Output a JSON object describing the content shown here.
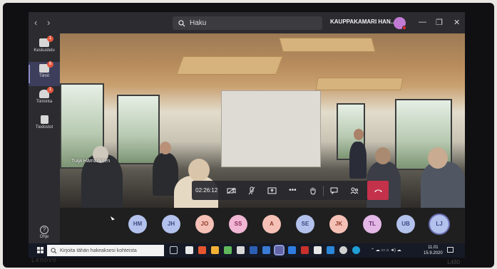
{
  "titlebar": {
    "back": "‹",
    "forward": "›",
    "search_placeholder": "Haku",
    "org_name": "KAUPPAKAMARI HAN...",
    "org_chevron": "⌄",
    "minimize": "—",
    "restore": "❐",
    "close": "✕"
  },
  "rail": {
    "items": [
      {
        "label": "Keskustelu",
        "badge": "1",
        "icon": "chat-icon"
      },
      {
        "label": "Tiimit",
        "badge": "6",
        "icon": "teams-icon",
        "active": true
      },
      {
        "label": "Toiminta",
        "badge": "1",
        "icon": "bell-icon"
      },
      {
        "label": "Tiedostot",
        "badge": "",
        "icon": "files-icon"
      }
    ],
    "help_label": "Ohje"
  },
  "stage": {
    "speaker_name": "Tuija Hämäläinen"
  },
  "controls": {
    "timer": "02:26:12",
    "camera_icon": "camera-off-icon",
    "mic_icon": "mic-off-icon",
    "share_icon": "share-screen-icon",
    "more": "•••",
    "hand_icon": "raise-hand-icon",
    "chat_icon": "chat-icon",
    "participants_icon": "participants-icon",
    "hangup_icon": "hang-up-icon"
  },
  "participants": [
    {
      "initials": "HM",
      "bg": "#b3c2ec",
      "fg": "#3d4a82"
    },
    {
      "initials": "JH",
      "bg": "#b3c2ec",
      "fg": "#3d4a82"
    },
    {
      "initials": "JO",
      "bg": "#f5c1b6",
      "fg": "#8f3a27"
    },
    {
      "initials": "SS",
      "bg": "#f0b6d3",
      "fg": "#8c2a5a"
    },
    {
      "initials": "A",
      "bg": "#f5c1b6",
      "fg": "#8f3a27"
    },
    {
      "initials": "SE",
      "bg": "#b3c2ec",
      "fg": "#3d4a82"
    },
    {
      "initials": "JK",
      "bg": "#f5c1b6",
      "fg": "#8f3a27"
    },
    {
      "initials": "TL",
      "bg": "#e3b7e6",
      "fg": "#6c2a73"
    },
    {
      "initials": "UB",
      "bg": "#b3c2ec",
      "fg": "#3d4a82"
    },
    {
      "initials": "LJ",
      "bg": "#b3c2ec",
      "fg": "#3d4a82",
      "selected": true
    }
  ],
  "taskbar": {
    "search_placeholder": "Kirjoita tähän hakeaksesi kohteista",
    "time": "11.01",
    "date": "15.9.2020"
  },
  "device": {
    "brand": "Lenovo",
    "model": "L480"
  },
  "colors": {
    "accent": "#6264a7",
    "hangup": "#c4314b",
    "badge": "#e0573e"
  }
}
